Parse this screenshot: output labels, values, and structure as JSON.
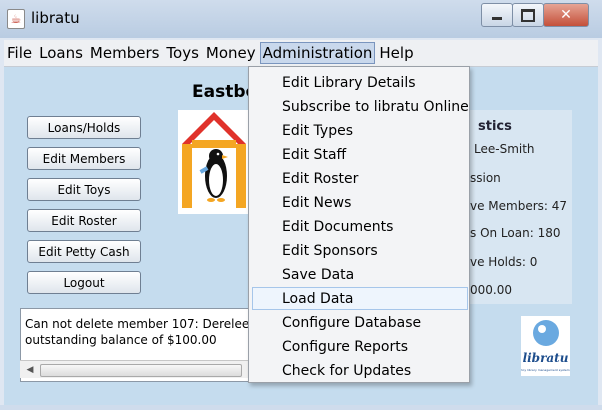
{
  "window": {
    "title": "libratu",
    "buttons": {
      "minimize": "minimize",
      "maximize": "maximize",
      "close": "✕"
    }
  },
  "menubar": {
    "items": [
      "File",
      "Loans",
      "Members",
      "Toys",
      "Money",
      "Administration",
      "Help"
    ],
    "active": "Administration"
  },
  "main": {
    "heading": "Eastbo",
    "buttons": [
      "Loans/Holds",
      "Edit Members",
      "Edit Toys",
      "Edit Roster",
      "Edit Petty Cash",
      "Logout"
    ]
  },
  "stats": {
    "title": "stics",
    "lines": [
      "Lee-Smith",
      "ssion",
      "ve Members: 47",
      "s On Loan: 180",
      "ve Holds: 0",
      "000.00"
    ]
  },
  "messages": {
    "lines": [
      "Can not delete member 107: Derelee a",
      "outstanding balance of $100.00"
    ]
  },
  "admin_menu": {
    "items": [
      "Edit Library Details",
      "Subscribe to libratu Online",
      "Edit Types",
      "Edit Staff",
      "Edit Roster",
      "Edit News",
      "Edit Documents",
      "Edit Sponsors",
      "Save Data",
      "Load Data",
      "Configure Database",
      "Configure Reports",
      "Check for Updates"
    ],
    "highlighted": "Save Data",
    "hovered": "Load Data"
  },
  "libratu_logo": {
    "name": "libratu",
    "tagline": "toy library management system"
  },
  "colors": {
    "highlight": "#ffff00",
    "panel": "#c5dcee",
    "menu_active": "#c9d8ec"
  }
}
